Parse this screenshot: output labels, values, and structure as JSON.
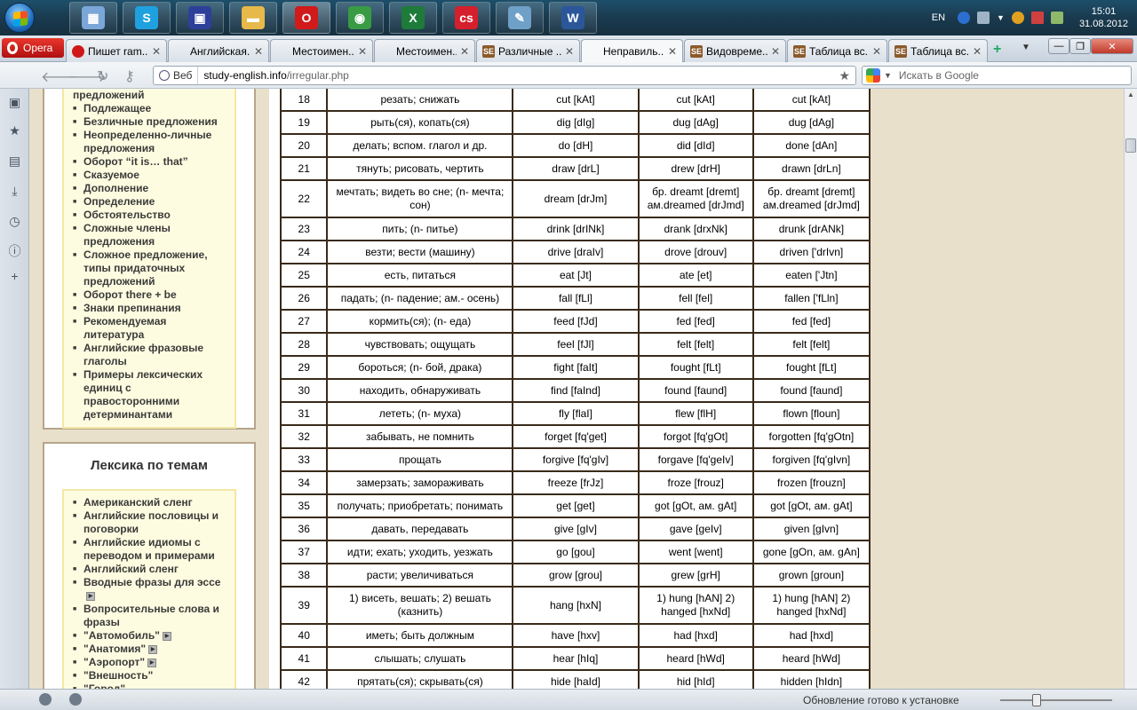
{
  "taskbar": {
    "apps": [
      {
        "name": "calculator",
        "glyph": "▦",
        "color": "#7aa7d8"
      },
      {
        "name": "skype",
        "glyph": "S",
        "color": "#1fa1e0"
      },
      {
        "name": "save",
        "glyph": "▣",
        "color": "#2e3f9a"
      },
      {
        "name": "explorer",
        "glyph": "▬",
        "color": "#e6b94a"
      },
      {
        "name": "opera",
        "glyph": "O",
        "color": "#d11a1a"
      },
      {
        "name": "chrome",
        "glyph": "◉",
        "color": "#3a9b45"
      },
      {
        "name": "excel",
        "glyph": "X",
        "color": "#1e7b3a"
      },
      {
        "name": "lastfm",
        "glyph": "cs",
        "color": "#d61f2c"
      },
      {
        "name": "paint",
        "glyph": "✎",
        "color": "#6fa0c8"
      },
      {
        "name": "word",
        "glyph": "W",
        "color": "#2b579a"
      }
    ],
    "language": "EN",
    "time": "15:01",
    "date": "31.08.2012"
  },
  "browser": {
    "menu_label": "Opera",
    "tabs": [
      {
        "title": "Пишет ram...",
        "fav": "opera"
      },
      {
        "title": "Английская...",
        "fav": "blank"
      },
      {
        "title": "Местоимен...",
        "fav": "blank"
      },
      {
        "title": "Местоимен...",
        "fav": "blank"
      },
      {
        "title": "Различные ...",
        "fav": "se"
      },
      {
        "title": "Неправиль...",
        "fav": "blank"
      },
      {
        "title": "Видовреме...",
        "fav": "se"
      },
      {
        "title": "Таблица вс...",
        "fav": "se"
      },
      {
        "title": "Таблица вс...",
        "fav": "se"
      }
    ],
    "web_label": "Веб",
    "url_host": "study-english.info",
    "url_path": "/irregular.php",
    "search_placeholder": "Искать в Google"
  },
  "sidebar": {
    "grammar_items": [
      "предложений",
      "Подлежащее",
      "Безличные предложения",
      "Неопределенно-личные предложения",
      "Оборот “it is… that”",
      "Сказуемое",
      "Дополнение",
      "Определение",
      "Обстоятельство",
      "Сложные члены предложения",
      "Сложное предложение, типы придаточных предложений",
      "Оборот there + be",
      "Знаки препинания",
      "Рекомендуемая литература",
      "Английские фразовые глаголы",
      "Примеры лексических единиц с правосторонними детерминантами"
    ],
    "topics_title": "Лексика по темам",
    "topic_items": [
      {
        "label": "Американский сленг",
        "arrow": false
      },
      {
        "label": "Английские пословицы и поговорки",
        "arrow": false
      },
      {
        "label": "Английские идиомы с переводом и примерами",
        "arrow": false
      },
      {
        "label": "Английский сленг",
        "arrow": false
      },
      {
        "label": "Вводные фразы для эссе",
        "arrow": true
      },
      {
        "label": "Вопросительные слова и фразы",
        "arrow": false
      },
      {
        "label": "\"Автомобиль\"",
        "arrow": true
      },
      {
        "label": "\"Анатомия\"",
        "arrow": true
      },
      {
        "label": "\"Аэропорт\"",
        "arrow": true
      },
      {
        "label": "\"Внешность\"",
        "arrow": false
      },
      {
        "label": "\"Город\"",
        "arrow": false
      }
    ]
  },
  "verbs": [
    {
      "n": "18",
      "ru": "резать; снижать",
      "v1": "cut [kAt]",
      "v2": "cut [kAt]",
      "v3": "cut [kAt]",
      "h": 26
    },
    {
      "n": "19",
      "ru": "рыть(ся), копать(ся)",
      "v1": "dig [dIg]",
      "v2": "dug [dAg]",
      "v3": "dug [dAg]",
      "h": 26
    },
    {
      "n": "20",
      "ru": "делать; вспом. глагол и др.",
      "v1": "do [dH]",
      "v2": "did [dId]",
      "v3": "done [dAn]",
      "h": 26
    },
    {
      "n": "21",
      "ru": "тянуть; рисовать, чертить",
      "v1": "draw [drL]",
      "v2": "drew [drH]",
      "v3": "drawn [drLn]",
      "h": 26
    },
    {
      "n": "22",
      "ru": "мечтать; видеть во сне; (n- мечта; сон)",
      "v1": "dream [drJm]",
      "v2": "бр. dreamt [dremt] ам.dreamed [drJmd]",
      "v3": "бр. dreamt [dremt] ам.dreamed [drJmd]",
      "h": 42
    },
    {
      "n": "23",
      "ru": "пить; (n- питье)",
      "v1": "drink [drINk]",
      "v2": "drank [drxNk]",
      "v3": "drunk [drANk]",
      "h": 26
    },
    {
      "n": "24",
      "ru": "везти; вести (машину)",
      "v1": "drive [draIv]",
      "v2": "drove [drouv]",
      "v3": "driven ['drIvn]",
      "h": 26
    },
    {
      "n": "25",
      "ru": "есть, питаться",
      "v1": "eat [Jt]",
      "v2": "ate [et]",
      "v3": "eaten ['Jtn]",
      "h": 26
    },
    {
      "n": "26",
      "ru": "падать; (n- падение; ам.- осень)",
      "v1": "fall [fLl]",
      "v2": "fell [fel]",
      "v3": "fallen ['fLln]",
      "h": 26
    },
    {
      "n": "27",
      "ru": "кормить(ся); (n- еда)",
      "v1": "feed [fJd]",
      "v2": "fed [fed]",
      "v3": "fed [fed]",
      "h": 26
    },
    {
      "n": "28",
      "ru": "чувствовать; ощущать",
      "v1": "feel [fJl]",
      "v2": "felt [felt]",
      "v3": "felt [felt]",
      "h": 26
    },
    {
      "n": "29",
      "ru": "бороться; (n- бой, драка)",
      "v1": "fight [faIt]",
      "v2": "fought [fLt]",
      "v3": "fought [fLt]",
      "h": 26
    },
    {
      "n": "30",
      "ru": "находить, обнаруживать",
      "v1": "find [faInd]",
      "v2": "found [faund]",
      "v3": "found [faund]",
      "h": 26
    },
    {
      "n": "31",
      "ru": "лететь; (n- муха)",
      "v1": "fly [flaI]",
      "v2": "flew [flH]",
      "v3": "flown [floun]",
      "h": 26
    },
    {
      "n": "32",
      "ru": "забывать, не помнить",
      "v1": "forget [fq'get]",
      "v2": "forgot [fq'gOt]",
      "v3": "forgotten [fq'gOtn]",
      "h": 26
    },
    {
      "n": "33",
      "ru": "прощать",
      "v1": "forgive [fq'gIv]",
      "v2": "forgave [fq'geIv]",
      "v3": "forgiven [fq'gIvn]",
      "h": 26
    },
    {
      "n": "34",
      "ru": "замерзать; замораживать",
      "v1": "freeze [frJz]",
      "v2": "froze [frouz]",
      "v3": "frozen [frouzn]",
      "h": 26
    },
    {
      "n": "35",
      "ru": "получать; приобретать; понимать",
      "v1": "get [get]",
      "v2": "got [gOt, ам. gAt]",
      "v3": "got [gOt, ам. gAt]",
      "h": 26
    },
    {
      "n": "36",
      "ru": "давать, передавать",
      "v1": "give [gIv]",
      "v2": "gave [geIv]",
      "v3": "given [gIvn]",
      "h": 26
    },
    {
      "n": "37",
      "ru": "идти; ехать; уходить, уезжать",
      "v1": "go [gou]",
      "v2": "went [went]",
      "v3": "gone [gOn, ам. gAn]",
      "h": 26
    },
    {
      "n": "38",
      "ru": "расти; увеличиваться",
      "v1": "grow [grou]",
      "v2": "grew [grH]",
      "v3": "grown [groun]",
      "h": 26
    },
    {
      "n": "39",
      "ru": "1) висеть, вешать; 2) вешать (казнить)",
      "v1": "hang [hxN]",
      "v2": "1) hung [hAN] 2) hanged [hxNd]",
      "v3": "1) hung [hAN] 2) hanged [hxNd]",
      "h": 42
    },
    {
      "n": "40",
      "ru": "иметь; быть должным",
      "v1": "have [hxv]",
      "v2": "had [hxd]",
      "v3": "had [hxd]",
      "h": 26
    },
    {
      "n": "41",
      "ru": "слышать; слушать",
      "v1": "hear [hIq]",
      "v2": "heard [hWd]",
      "v3": "heard [hWd]",
      "h": 26
    },
    {
      "n": "42",
      "ru": "прятать(ся); скрывать(ся)",
      "v1": "hide [haId]",
      "v2": "hid [hId]",
      "v3": "hidden [hIdn]",
      "h": 26
    }
  ],
  "status": {
    "message": "Обновление готово к установке"
  }
}
